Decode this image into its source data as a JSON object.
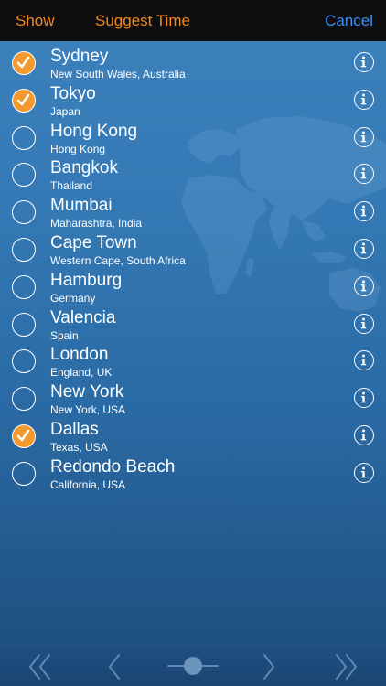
{
  "toolbar": {
    "show_label": "Show",
    "suggest_label": "Suggest Time",
    "cancel_label": "Cancel"
  },
  "colors": {
    "accent_orange": "#f08a1c",
    "accent_blue": "#3a8ff0",
    "check_fill": "#f29a2e"
  },
  "cities": [
    {
      "name": "Sydney",
      "region": "New South Wales, Australia",
      "selected": true
    },
    {
      "name": "Tokyo",
      "region": "Japan",
      "selected": true
    },
    {
      "name": "Hong Kong",
      "region": "Hong Kong",
      "selected": false
    },
    {
      "name": "Bangkok",
      "region": "Thailand",
      "selected": false
    },
    {
      "name": "Mumbai",
      "region": "Maharashtra, India",
      "selected": false
    },
    {
      "name": "Cape Town",
      "region": "Western Cape, South Africa",
      "selected": false
    },
    {
      "name": "Hamburg",
      "region": "Germany",
      "selected": false
    },
    {
      "name": "Valencia",
      "region": "Spain",
      "selected": false
    },
    {
      "name": "London",
      "region": "England, UK",
      "selected": false
    },
    {
      "name": "New York",
      "region": "New York, USA",
      "selected": false
    },
    {
      "name": "Dallas",
      "region": "Texas, USA",
      "selected": true
    },
    {
      "name": "Redondo Beach",
      "region": "California, USA",
      "selected": false
    }
  ],
  "icons": {
    "row_info": "info-icon",
    "checkbox": "checkmark-icon",
    "nav_first": "double-chevron-left-icon",
    "nav_prev": "chevron-left-icon",
    "nav_slider": "slider-knob-icon",
    "nav_next": "chevron-right-icon",
    "nav_last": "double-chevron-right-icon"
  }
}
